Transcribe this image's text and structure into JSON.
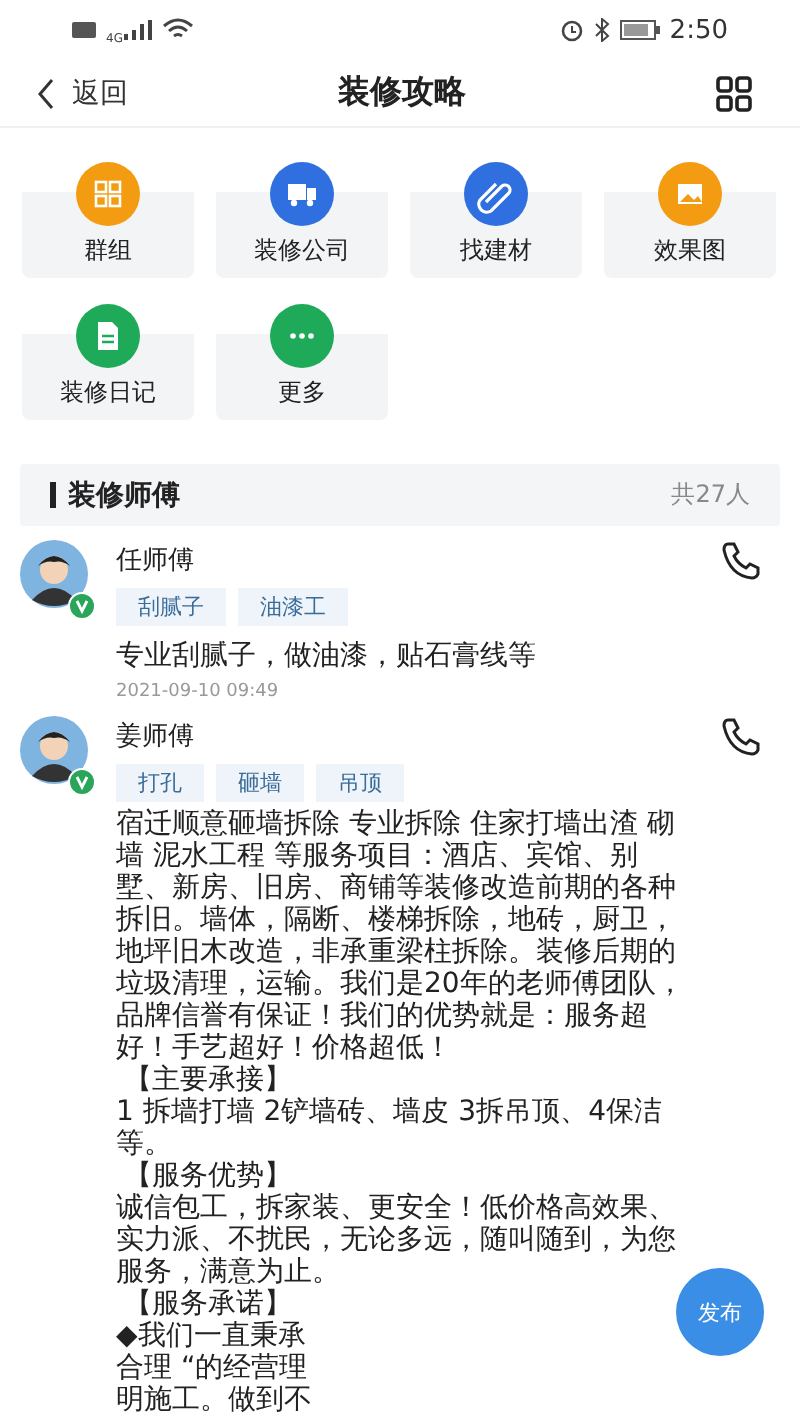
{
  "status_bar": {
    "network": "4G",
    "time": "2:50"
  },
  "header": {
    "back": "返回",
    "title": "装修攻略"
  },
  "shortcuts": [
    {
      "label": "群组",
      "kind": "group",
      "color": "#f39c12"
    },
    {
      "label": "装修公司",
      "kind": "truck",
      "color": "#2f6fe0"
    },
    {
      "label": "找建材",
      "kind": "clip",
      "color": "#2f6fe0"
    },
    {
      "label": "效果图",
      "kind": "image",
      "color": "#f39c12"
    },
    {
      "label": "装修日记",
      "kind": "doc",
      "color": "#1faa5a"
    },
    {
      "label": "更多",
      "kind": "more",
      "color": "#1faa5a"
    }
  ],
  "section": {
    "title": "装修师傅",
    "count": "共27人"
  },
  "workers": [
    {
      "name": "任师傅",
      "verified": true,
      "tags": [
        "刮腻子",
        "油漆工"
      ],
      "description": "专业刮腻子，做油漆，贴石膏线等",
      "date": "2021-09-10 09:49"
    },
    {
      "name": "姜师傅",
      "verified": true,
      "tags": [
        "打孔",
        "砸墙",
        "吊顶"
      ],
      "description_lines": [
        "宿迁顺意砸墙拆除 专业拆除 住家打墙出渣 砌",
        "墙 泥水工程 等服务项目：酒店、宾馆、别",
        "墅、新房、旧房、商铺等装修改造前期的各种",
        "拆旧。墙体，隔断、楼梯拆除，地砖，厨卫，",
        "地坪旧木改造，非承重梁柱拆除。装修后期的",
        "垃圾清理，运输。我们是20年的老师傅团队，",
        "品牌信誉有保证！我们的优势就是：服务超",
        "好！手艺超好！价格超低！",
        "【主要承接】",
        "1 拆墙打墙 2铲墙砖、墙皮 3拆吊顶、4保洁",
        "等。",
        "【服务优势】",
        "诚信包工，拆家装、更安全！低价格高效果、",
        "实力派、不扰民，无论多远，随叫随到，为您",
        "服务，满意为止。",
        "【服务承诺】",
        "◆我们一直秉承",
        "合理 “的经营理",
        "明施工。做到不"
      ]
    }
  ],
  "fab": {
    "label": "发布"
  }
}
